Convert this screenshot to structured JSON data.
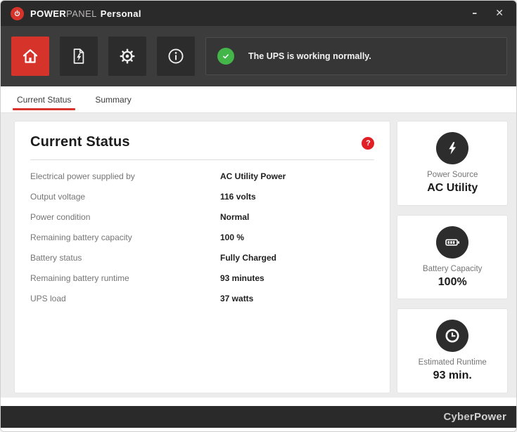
{
  "titlebar": {
    "brand": {
      "part1": "POWER",
      "part2": "PANEL",
      "part3": "Personal"
    },
    "controls": {
      "minimize_glyph": "–",
      "close_glyph": "✕"
    }
  },
  "toolbar": {
    "status_message": "The UPS is working normally.",
    "icons": [
      "home-icon",
      "event-log-icon",
      "gear-icon",
      "info-icon"
    ]
  },
  "tabs": {
    "current_status": "Current Status",
    "summary": "Summary"
  },
  "panel": {
    "heading": "Current Status",
    "help_glyph": "?",
    "rows": [
      {
        "label": "Electrical power supplied by",
        "value": "AC Utility Power"
      },
      {
        "label": "Output voltage",
        "value": "116 volts"
      },
      {
        "label": "Power condition",
        "value": "Normal"
      },
      {
        "label": "Remaining battery capacity",
        "value": "100 %"
      },
      {
        "label": "Battery status",
        "value": "Fully Charged"
      },
      {
        "label": "Remaining battery runtime",
        "value": "93 minutes"
      },
      {
        "label": "UPS load",
        "value": "37 watts"
      }
    ]
  },
  "cards": [
    {
      "icon": "bolt-icon",
      "label": "Power Source",
      "value": "AC Utility"
    },
    {
      "icon": "battery-icon",
      "label": "Battery Capacity",
      "value": "100%"
    },
    {
      "icon": "clock-icon",
      "label": "Estimated Runtime",
      "value": "93 min."
    }
  ],
  "footer": {
    "brand_part1": "Cyber",
    "brand_part2": "Power"
  },
  "colors": {
    "accent_red": "#d6332b",
    "status_green": "#43b549",
    "titlebar_bg": "#2b2a2a",
    "toolbar_bg": "#3d3c3c",
    "toolbar_button_bg": "#2d2c2c",
    "content_bg": "#ececec",
    "card_icon_bg": "#2e2d2d",
    "label_gray": "#757575"
  }
}
